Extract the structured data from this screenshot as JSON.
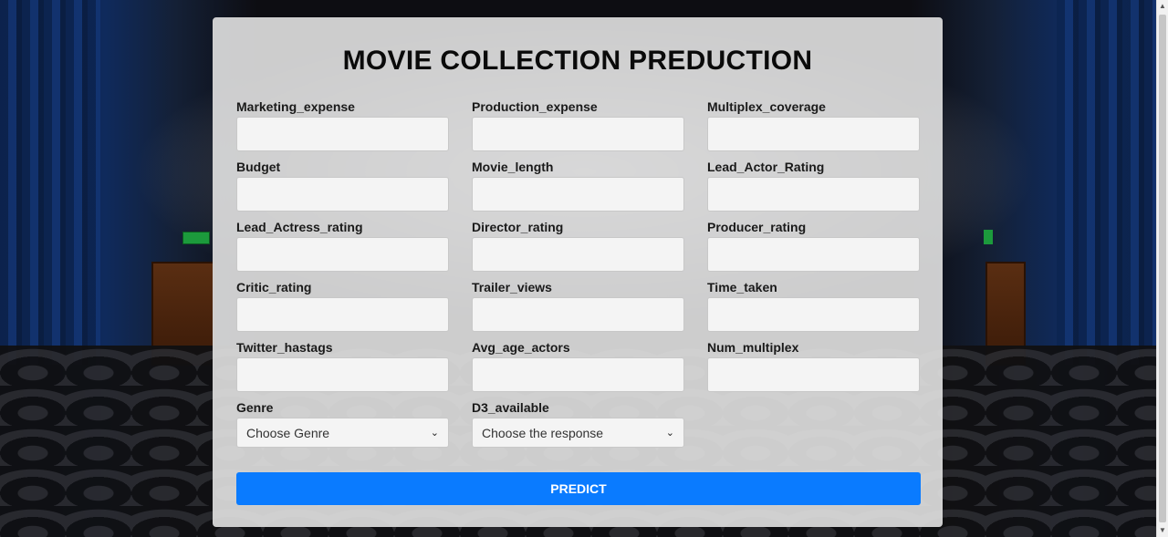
{
  "title": "MOVIE COLLECTION PREDUCTION",
  "fields": [
    {
      "label": "Marketing_expense",
      "value": "",
      "placeholder": ""
    },
    {
      "label": "Production_expense",
      "value": "",
      "placeholder": ""
    },
    {
      "label": "Multiplex_coverage",
      "value": "",
      "placeholder": ""
    },
    {
      "label": "Budget",
      "value": "",
      "placeholder": ""
    },
    {
      "label": "Movie_length",
      "value": "",
      "placeholder": ""
    },
    {
      "label": "Lead_Actor_Rating",
      "value": "",
      "placeholder": ""
    },
    {
      "label": "Lead_Actress_rating",
      "value": "",
      "placeholder": ""
    },
    {
      "label": "Director_rating",
      "value": "",
      "placeholder": ""
    },
    {
      "label": "Producer_rating",
      "value": "",
      "placeholder": ""
    },
    {
      "label": "Critic_rating",
      "value": "",
      "placeholder": ""
    },
    {
      "label": "Trailer_views",
      "value": "",
      "placeholder": ""
    },
    {
      "label": "Time_taken",
      "value": "",
      "placeholder": ""
    },
    {
      "label": "Twitter_hastags",
      "value": "",
      "placeholder": ""
    },
    {
      "label": "Avg_age_actors",
      "value": "",
      "placeholder": ""
    },
    {
      "label": "Num_multiplex",
      "value": "",
      "placeholder": ""
    }
  ],
  "selects": [
    {
      "label": "Genre",
      "selected": "Choose Genre"
    },
    {
      "label": "D3_available",
      "selected": "Choose the response"
    }
  ],
  "predict_label": "PREDICT",
  "colors": {
    "accent": "#0a7bff",
    "card": "#e2e2e2"
  },
  "icons": {
    "select_chevron": "chevron-down-icon"
  }
}
